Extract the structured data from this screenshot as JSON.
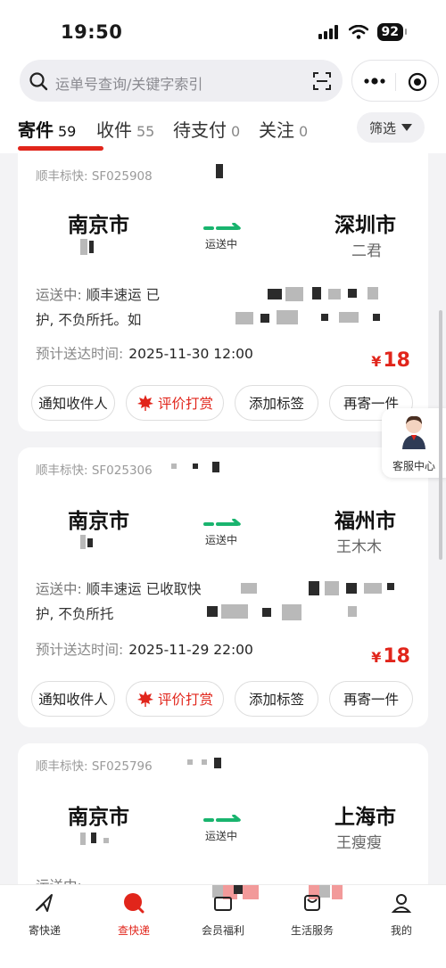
{
  "status_bar": {
    "time": "19:50",
    "battery": "92"
  },
  "search": {
    "placeholder": "运单号查询/关键字索引"
  },
  "tabs": [
    {
      "label": "寄件",
      "count": "59"
    },
    {
      "label": "收件",
      "count": "55"
    },
    {
      "label": "待支付",
      "count": "0"
    },
    {
      "label": "关注",
      "count": "0"
    }
  ],
  "filter_label": "筛选",
  "cards": [
    {
      "tracking": "顺丰标快: SF025908",
      "from_city": "南京市",
      "to_city": "深圳市",
      "to_person": "二君",
      "status": "运送中",
      "desc_prefix": "运送中:",
      "desc_line1": "顺丰速运 已",
      "desc_line2": "护, 不负所托。如",
      "eta_label": "预计送达时间:",
      "eta_value": "2025-11-30 12:00",
      "price": "18"
    },
    {
      "tracking": "顺丰标快: SF025306",
      "from_city": "南京市",
      "to_city": "福州市",
      "to_person": "王木木",
      "status": "运送中",
      "desc_prefix": "运送中:",
      "desc_line1": "顺丰速运 已收取快",
      "desc_line2": "护, 不负所托",
      "eta_label": "预计送达时间:",
      "eta_value": "2025-11-29 22:00",
      "price": "18"
    },
    {
      "tracking": "顺丰标快: SF025796",
      "from_city": "南京市",
      "to_city": "上海市",
      "to_person": "王瘦瘦",
      "status": "运送中",
      "desc_prefix": "运送中:"
    }
  ],
  "actions": {
    "notify": "通知收件人",
    "rate": "评价打赏",
    "tag": "添加标签",
    "resend": "再寄一件"
  },
  "price_symbol": "¥",
  "service_label": "客服中心",
  "bottom_nav": [
    {
      "label": "寄快递",
      "icon": "send-icon"
    },
    {
      "label": "查快递",
      "icon": "query-icon"
    },
    {
      "label": "会员福利",
      "icon": "member-icon"
    },
    {
      "label": "生活服务",
      "icon": "life-icon"
    },
    {
      "label": "我的",
      "icon": "profile-icon"
    }
  ],
  "colors": {
    "brand_red": "#e1251b",
    "accent_green": "#19b46e"
  }
}
